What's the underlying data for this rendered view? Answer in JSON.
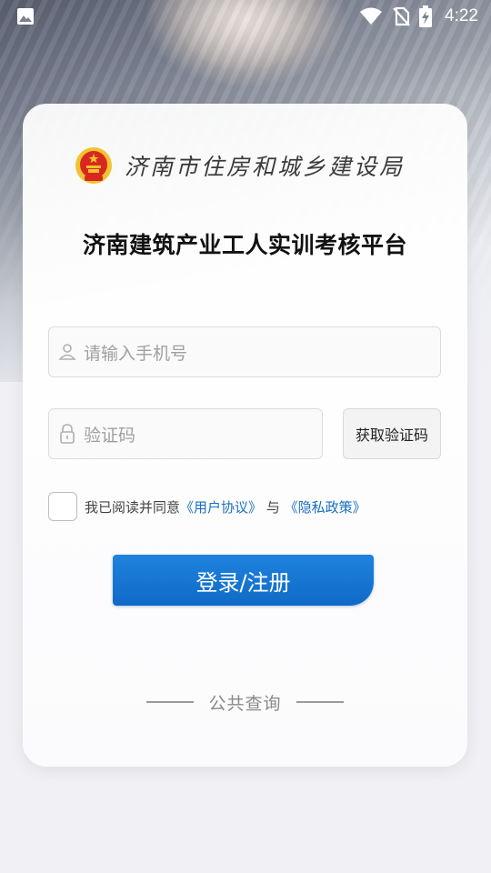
{
  "status_bar": {
    "time": "4:22",
    "icons": [
      "image-icon",
      "wifi-icon",
      "no-sim-icon",
      "battery-charging-icon"
    ]
  },
  "header": {
    "org_name": "济南市住房和城乡建设局",
    "emblem_icon": "national-emblem-icon",
    "app_title": "济南建筑产业工人实训考核平台"
  },
  "login": {
    "phone_placeholder": "请输入手机号",
    "code_placeholder": "验证码",
    "get_code_label": "获取验证码",
    "agreement": {
      "prefix": "我已阅读并同意",
      "user_agreement": "《用户协议》",
      "conjunction": "与",
      "privacy_policy": "《隐私政策》"
    },
    "submit_label": "登录/注册"
  },
  "footer": {
    "public_query_label": "公共查询"
  },
  "colors": {
    "accent": "#1a74cf",
    "link": "#1a6fc2",
    "emblem_red": "#d8281d",
    "emblem_gold": "#f2c233"
  }
}
